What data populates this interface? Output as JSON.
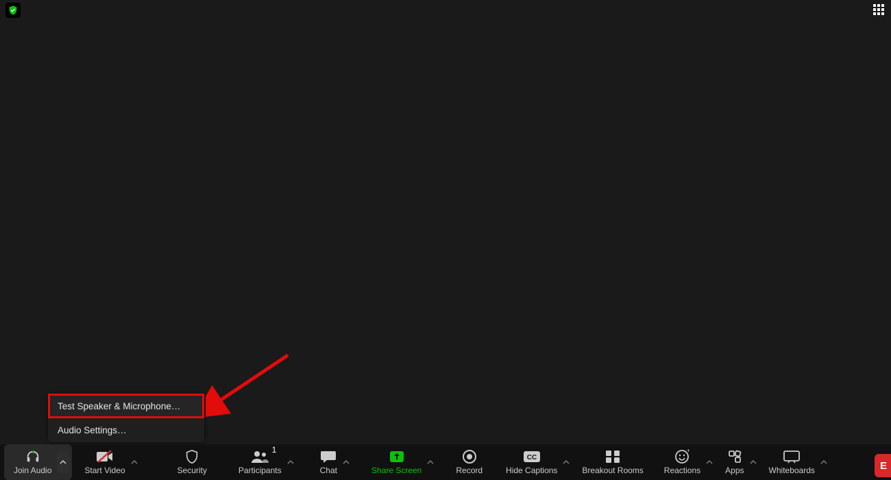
{
  "menu": {
    "test_speaker": "Test Speaker & Microphone…",
    "audio_settings": "Audio Settings…"
  },
  "toolbar": {
    "join_audio": "Join Audio",
    "start_video": "Start Video",
    "security": "Security",
    "participants": "Participants",
    "participants_count": "1",
    "chat": "Chat",
    "share_screen": "Share Screen",
    "record": "Record",
    "hide_captions": "Hide Captions",
    "breakout_rooms": "Breakout Rooms",
    "reactions": "Reactions",
    "apps": "Apps",
    "whiteboards": "Whiteboards",
    "end": "E"
  }
}
